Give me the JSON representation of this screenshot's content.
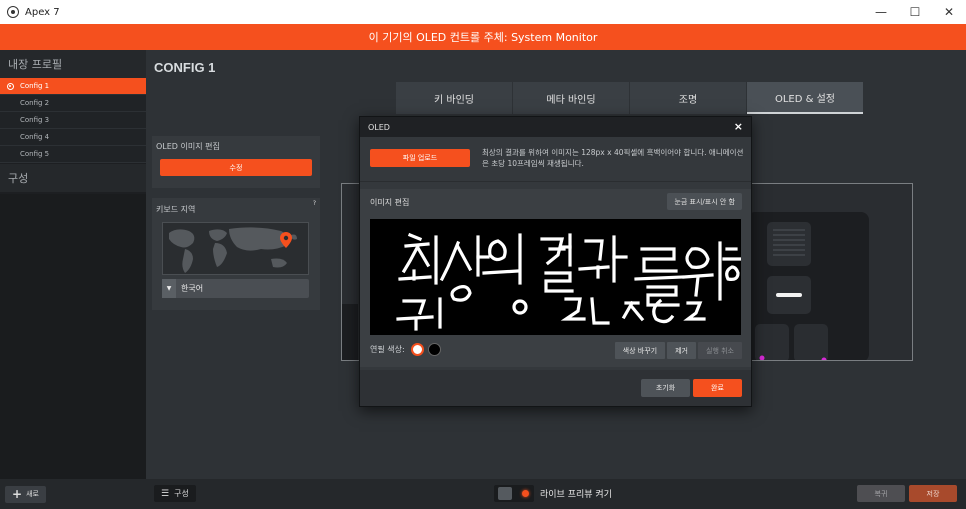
{
  "window": {
    "title": "Apex 7",
    "minimize_glyph": "—",
    "maximize_glyph": "☐",
    "close_glyph": "✕"
  },
  "banner": {
    "text": "이 기기의 OLED 컨트롤 주체: System Monitor"
  },
  "sidebar": {
    "profiles_title": "내장 프로필",
    "configs": [
      {
        "label": "Config 1",
        "active": true
      },
      {
        "label": "Config 2",
        "active": false
      },
      {
        "label": "Config 3",
        "active": false
      },
      {
        "label": "Config 4",
        "active": false
      },
      {
        "label": "Config 5",
        "active": false
      }
    ],
    "compose_title": "구성",
    "new_button": "새로"
  },
  "main": {
    "page_title": "CONFIG 1",
    "tabs": [
      {
        "label": "키 바인딩",
        "active": false
      },
      {
        "label": "메타 바인딩",
        "active": false
      },
      {
        "label": "조명",
        "active": false
      },
      {
        "label": "OLED & 설정",
        "active": true
      }
    ],
    "oled_panel": {
      "title": "OLED 이미지 편집",
      "edit_button": "수정"
    },
    "region_panel": {
      "title": "키보드 지역",
      "help_glyph": "?",
      "language": "한국어"
    }
  },
  "bottom_bar": {
    "compose_button": "구성",
    "live_preview_label": "라이브 프리뷰 켜기",
    "revert_button": "복귀",
    "save_button": "저장"
  },
  "modal": {
    "title": "OLED",
    "close_glyph": "×",
    "upload_button": "파일 업로드",
    "info_text": "최상의 결과를 위하여 이미지는 128px x 40픽셀에 흑백이어야 합니다. 애니메이션은 초당 10프레임씩 재생됩니다.",
    "editor_title": "이미지 편집",
    "grid_toggle_button": "눈금 표시/표시 안 함",
    "pen_color_label": "연필 색상:",
    "invert_button": "색상 바꾸기",
    "clear_button": "제거",
    "undo_button": "실행 취소",
    "reset_button": "초기화",
    "done_button": "완료"
  },
  "colors": {
    "accent": "#f5501e",
    "pen_white": "#ffffff",
    "pen_black": "#000000"
  }
}
